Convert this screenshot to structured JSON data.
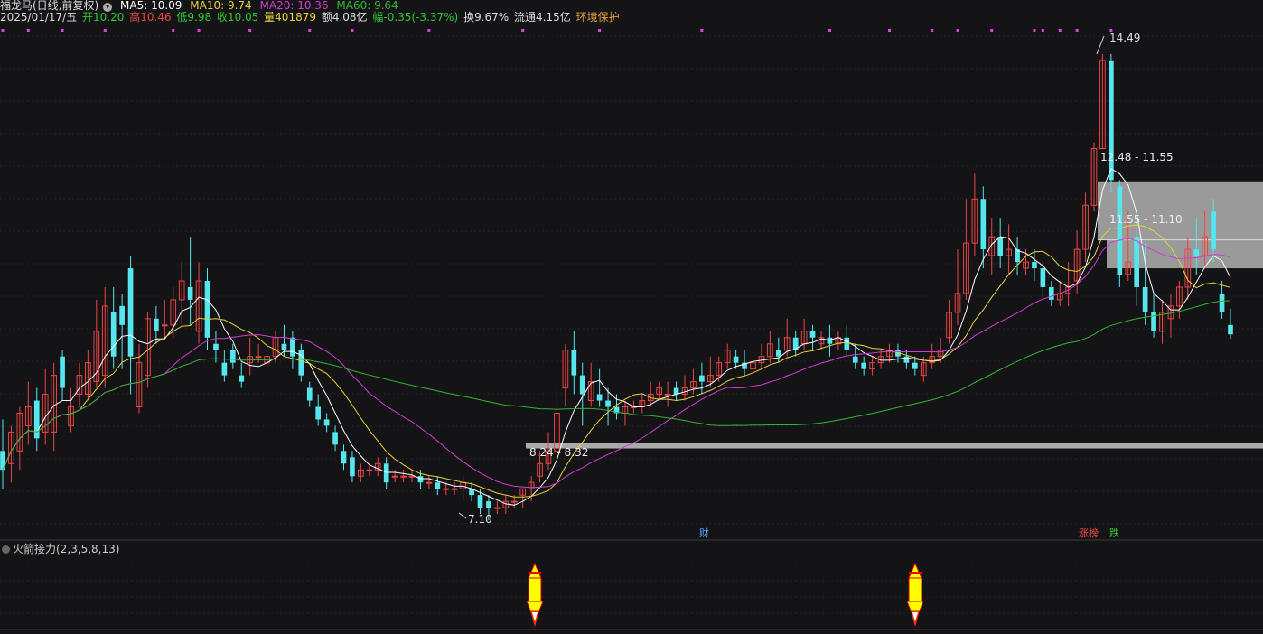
{
  "header": {
    "title": "福龙马(日线,前复权)",
    "ma5": "MA5: 10.09",
    "ma10": "MA10: 9.74",
    "ma20": "MA20: 10.36",
    "ma60": "MA60: 9.64",
    "date": "2025/01/17/五",
    "open": "开10.20",
    "high": "高10.46",
    "low": "低9.98",
    "close": "收10.05",
    "volume": "量401879",
    "amount": "额4.08亿",
    "change": "幅-0.35(-3.37%)",
    "turnover": "换9.67%",
    "float": "流通4.15亿",
    "tag": "环境保护"
  },
  "colors": {
    "up": "#ee4444",
    "down": "#55e6ee",
    "ma5": "#ffffff",
    "ma10": "#e6d23c",
    "ma20": "#d23cd2",
    "ma60": "#32b432",
    "zone": "#9a9a9a",
    "marker": "#e040e0"
  },
  "annotations": {
    "high_price": "14.49",
    "low_price": "7.10",
    "zone1": "12.48 - 11.55",
    "zone2": "11.55 - 11.10",
    "zone3": "8.24 - 8.32",
    "cai_badge": "财",
    "zhangbang_badge": "涨榜",
    "die_badge": "跌"
  },
  "indicator": {
    "name": "火箭接力(2,3,5,8,13)"
  },
  "chart_data": {
    "type": "candlestick",
    "title": "福龙马(日线,前复权)",
    "candles": [
      [
        8.2,
        7.9,
        7.6,
        8.7
      ],
      [
        8.0,
        8.5,
        7.7,
        8.6
      ],
      [
        8.2,
        8.8,
        7.9,
        8.9
      ],
      [
        8.6,
        8.9,
        8.3,
        9.3
      ],
      [
        9.0,
        8.4,
        8.2,
        9.2
      ],
      [
        8.5,
        9.1,
        8.3,
        9.5
      ],
      [
        8.5,
        9.4,
        8.2,
        9.6
      ],
      [
        9.7,
        9.2,
        9.0,
        9.8
      ],
      [
        8.6,
        8.9,
        8.5,
        9.2
      ],
      [
        9.1,
        9.4,
        8.9,
        9.6
      ],
      [
        9.1,
        9.6,
        9.0,
        9.8
      ],
      [
        9.3,
        10.1,
        9.2,
        10.6
      ],
      [
        9.4,
        10.5,
        9.2,
        10.8
      ],
      [
        10.4,
        9.7,
        9.5,
        10.8
      ],
      [
        10.5,
        10.2,
        9.5,
        10.7
      ],
      [
        11.1,
        9.7,
        9.1,
        11.3
      ],
      [
        8.9,
        9.6,
        8.8,
        9.9
      ],
      [
        9.4,
        10.3,
        9.2,
        10.4
      ],
      [
        10.3,
        10.1,
        9.9,
        10.5
      ],
      [
        10.2,
        10.2,
        10.0,
        10.6
      ],
      [
        10.2,
        10.6,
        10.0,
        10.8
      ],
      [
        10.6,
        10.9,
        10.2,
        11.2
      ],
      [
        10.8,
        10.6,
        10.2,
        11.6
      ],
      [
        10.1,
        10.9,
        9.9,
        11.2
      ],
      [
        10.9,
        10.0,
        9.8,
        11.1
      ],
      [
        9.9,
        9.8,
        9.6,
        10.1
      ],
      [
        9.6,
        9.4,
        9.3,
        9.8
      ],
      [
        9.8,
        9.6,
        9.5,
        9.9
      ],
      [
        9.4,
        9.3,
        9.2,
        9.6
      ],
      [
        9.6,
        9.7,
        9.4,
        10.0
      ],
      [
        9.7,
        9.7,
        9.6,
        9.9
      ],
      [
        9.6,
        9.7,
        9.5,
        9.9
      ],
      [
        9.7,
        10.0,
        9.6,
        10.1
      ],
      [
        9.9,
        9.8,
        9.7,
        10.2
      ],
      [
        10.0,
        9.7,
        9.5,
        10.1
      ],
      [
        9.8,
        9.4,
        9.3,
        9.9
      ],
      [
        9.2,
        9.0,
        8.9,
        9.3
      ],
      [
        8.9,
        8.7,
        8.6,
        9.1
      ],
      [
        8.7,
        8.6,
        8.5,
        8.8
      ],
      [
        8.5,
        8.3,
        8.2,
        8.6
      ],
      [
        8.2,
        8.0,
        7.9,
        8.3
      ],
      [
        8.1,
        7.8,
        7.7,
        8.2
      ],
      [
        7.8,
        7.9,
        7.7,
        8.0
      ],
      [
        7.9,
        7.9,
        7.8,
        8.0
      ],
      [
        7.9,
        8.0,
        7.8,
        8.1
      ],
      [
        8.0,
        7.7,
        7.6,
        8.1
      ],
      [
        7.8,
        7.8,
        7.7,
        7.9
      ],
      [
        7.8,
        7.8,
        7.7,
        7.9
      ],
      [
        7.8,
        7.8,
        7.7,
        7.9
      ],
      [
        7.8,
        7.7,
        7.6,
        7.9
      ],
      [
        7.7,
        7.7,
        7.6,
        7.8
      ],
      [
        7.7,
        7.6,
        7.5,
        7.8
      ],
      [
        7.6,
        7.6,
        7.5,
        7.7
      ],
      [
        7.6,
        7.6,
        7.5,
        7.7
      ],
      [
        7.6,
        7.7,
        7.4,
        7.8
      ],
      [
        7.6,
        7.5,
        7.4,
        7.7
      ],
      [
        7.5,
        7.3,
        7.2,
        7.6
      ],
      [
        7.4,
        7.3,
        7.1,
        7.5
      ],
      [
        7.3,
        7.3,
        7.2,
        7.4
      ],
      [
        7.3,
        7.4,
        7.2,
        7.5
      ],
      [
        7.4,
        7.4,
        7.3,
        7.5
      ],
      [
        7.5,
        7.6,
        7.3,
        7.6
      ],
      [
        7.6,
        7.7,
        7.4,
        7.8
      ],
      [
        7.8,
        8.0,
        7.7,
        8.2
      ],
      [
        8.0,
        8.2,
        7.9,
        8.5
      ],
      [
        8.2,
        8.8,
        8.1,
        9.2
      ],
      [
        9.2,
        9.8,
        8.9,
        9.9
      ],
      [
        9.8,
        9.4,
        9.1,
        10.1
      ],
      [
        9.4,
        9.1,
        8.6,
        9.6
      ],
      [
        9.0,
        9.3,
        8.9,
        9.6
      ],
      [
        9.1,
        9.0,
        8.9,
        9.5
      ],
      [
        9.0,
        8.9,
        8.6,
        9.2
      ],
      [
        8.9,
        8.8,
        8.7,
        9.1
      ],
      [
        8.8,
        8.9,
        8.6,
        9.0
      ],
      [
        8.9,
        8.9,
        8.8,
        9.0
      ],
      [
        8.9,
        9.0,
        8.8,
        9.1
      ],
      [
        9.0,
        9.1,
        8.9,
        9.3
      ],
      [
        9.1,
        9.2,
        9.0,
        9.3
      ],
      [
        9.1,
        9.1,
        8.9,
        9.3
      ],
      [
        9.2,
        9.1,
        9.0,
        9.3
      ],
      [
        9.1,
        9.2,
        9.0,
        9.4
      ],
      [
        9.2,
        9.3,
        9.1,
        9.5
      ],
      [
        9.4,
        9.3,
        9.1,
        9.6
      ],
      [
        9.3,
        9.4,
        9.2,
        9.7
      ],
      [
        9.4,
        9.6,
        9.3,
        9.7
      ],
      [
        9.6,
        9.8,
        9.5,
        9.9
      ],
      [
        9.7,
        9.6,
        9.5,
        9.8
      ],
      [
        9.6,
        9.5,
        9.4,
        9.8
      ],
      [
        9.5,
        9.6,
        9.4,
        9.7
      ],
      [
        9.6,
        9.7,
        9.5,
        9.9
      ],
      [
        9.7,
        9.9,
        9.6,
        10.1
      ],
      [
        9.8,
        9.7,
        9.6,
        10.0
      ],
      [
        9.8,
        10.0,
        9.7,
        10.3
      ],
      [
        10.0,
        9.8,
        9.7,
        10.1
      ],
      [
        9.9,
        10.1,
        9.8,
        10.3
      ],
      [
        10.1,
        10.0,
        9.8,
        10.2
      ],
      [
        9.9,
        10.0,
        9.8,
        10.1
      ],
      [
        10.0,
        9.9,
        9.7,
        10.2
      ],
      [
        9.9,
        10.0,
        9.8,
        10.1
      ],
      [
        10.0,
        9.8,
        9.7,
        10.2
      ],
      [
        9.7,
        9.6,
        9.5,
        9.9
      ],
      [
        9.6,
        9.5,
        9.4,
        9.7
      ],
      [
        9.5,
        9.6,
        9.4,
        9.7
      ],
      [
        9.6,
        9.7,
        9.5,
        9.8
      ],
      [
        9.7,
        9.8,
        9.6,
        9.9
      ],
      [
        9.8,
        9.7,
        9.6,
        9.9
      ],
      [
        9.7,
        9.6,
        9.5,
        9.8
      ],
      [
        9.6,
        9.5,
        9.4,
        9.7
      ],
      [
        9.4,
        9.6,
        9.3,
        9.7
      ],
      [
        9.6,
        9.7,
        9.5,
        9.9
      ],
      [
        9.7,
        9.8,
        9.6,
        10.0
      ],
      [
        10.0,
        10.4,
        9.9,
        10.6
      ],
      [
        10.4,
        10.7,
        10.2,
        11.4
      ],
      [
        10.7,
        11.5,
        10.6,
        12.2
      ],
      [
        11.5,
        12.2,
        11.3,
        12.6
      ],
      [
        12.2,
        11.4,
        11.1,
        12.4
      ],
      [
        11.3,
        11.6,
        11.0,
        11.9
      ],
      [
        11.6,
        11.3,
        11.1,
        11.9
      ],
      [
        11.3,
        11.4,
        11.0,
        11.8
      ],
      [
        11.4,
        11.2,
        11.0,
        11.6
      ],
      [
        11.1,
        11.2,
        11.0,
        11.4
      ],
      [
        11.2,
        11.1,
        10.9,
        11.4
      ],
      [
        11.1,
        10.8,
        10.6,
        11.2
      ],
      [
        10.8,
        10.6,
        10.5,
        10.9
      ],
      [
        10.6,
        10.7,
        10.5,
        10.9
      ],
      [
        10.7,
        10.8,
        10.5,
        11.2
      ],
      [
        10.9,
        11.4,
        10.7,
        11.7
      ],
      [
        11.4,
        12.1,
        11.2,
        12.3
      ],
      [
        12.1,
        13.0,
        12.0,
        13.1
      ],
      [
        13.0,
        14.4,
        13.0,
        14.5
      ],
      [
        14.4,
        12.5,
        12.3,
        14.5
      ],
      [
        12.4,
        11.0,
        10.8,
        12.5
      ],
      [
        11.0,
        11.2,
        10.9,
        12.0
      ],
      [
        11.6,
        10.8,
        10.5,
        12.0
      ],
      [
        10.8,
        10.4,
        10.2,
        11.5
      ],
      [
        10.4,
        10.1,
        10.0,
        10.7
      ],
      [
        10.1,
        10.4,
        9.9,
        10.6
      ],
      [
        10.3,
        10.5,
        10.0,
        10.7
      ],
      [
        10.5,
        10.8,
        10.3,
        10.9
      ],
      [
        10.8,
        11.4,
        10.6,
        11.6
      ],
      [
        11.4,
        11.3,
        11.0,
        11.9
      ],
      [
        11.3,
        11.6,
        11.1,
        12.0
      ],
      [
        12.0,
        11.4,
        11.2,
        12.2
      ],
      [
        10.7,
        10.4,
        10.3,
        10.9
      ],
      [
        10.2,
        10.05,
        9.98,
        10.46
      ]
    ],
    "ma_labels": [
      "MA5",
      "MA10",
      "MA20",
      "MA60"
    ],
    "ylim": [
      6.9,
      15.0
    ]
  }
}
